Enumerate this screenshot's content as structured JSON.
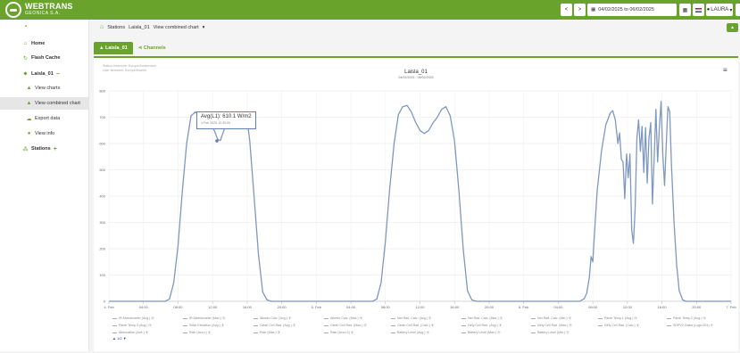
{
  "app": {
    "brand": "WEBTRANS",
    "brand_sub": "GEONICA S.A."
  },
  "topbar": {
    "prev": "<",
    "next": ">",
    "date_range": "04/02/2025 to 06/02/2025",
    "user": "LAURA"
  },
  "sidebar": {
    "items": [
      {
        "label": "Home",
        "icon": "home-icon"
      },
      {
        "label": "Flash Cache",
        "icon": "refresh-icon"
      },
      {
        "label": "Laisla_01",
        "icon": "map-marker-icon"
      },
      {
        "label": "View charts",
        "icon": "chart-icon"
      },
      {
        "label": "View combined chart",
        "icon": "chart-icon"
      },
      {
        "label": "Export data",
        "icon": "cloud-download-icon"
      },
      {
        "label": "View info",
        "icon": "info-icon"
      },
      {
        "label": "Stations",
        "icon": "sitemap-icon"
      }
    ],
    "collapse_sign": "−",
    "add_sign": "+"
  },
  "breadcrumb": {
    "items": [
      "Stations",
      "Laisla_01",
      "View combined chart"
    ]
  },
  "tabs": {
    "station": "Laisla_01",
    "channels": "Channels"
  },
  "chart": {
    "tz_station": "Station timezone: Europe/Amsterdam",
    "tz_user": "User timezone: Europe/Madrid",
    "menu_glyph": "≡",
    "tooltip_value": "Avg(L1): 610.1 W/m2",
    "tooltip_time": "4 Feb 2025 12:30:00",
    "legend_more": "▲ 1/2 ▼",
    "legend": [
      "IR Albedometer (Avg.) ⦿",
      "IR Albedometer (Max.) ⦿",
      "Albedo Calc. (Avg.) ⦿",
      "Albedo Calc. (Max.) ⦿",
      "Net Rad. Calc. (Avg.) ⦿",
      "Net Rad. Calc. (Max.) ⦿",
      "Net Rad. Calc. (Min.) ⦿",
      "Panel Temp.1 (Avg.) ⦿",
      "Panel Temp.2 (Avg.) ⦿",
      "Panel Temp.3 (Avg.) ⦿",
      "Solar Elevation (Avg.) ⦿",
      "Clean Cell Rad. (Avg.) ⦿",
      "Clean Cell Rad. (Max.) ⦿",
      "Clean Cell Rad. (Calc.) ⦿",
      "Dirty Cell Rad. (Avg.) ⦿",
      "Dirty Cell Rad. (Max.) ⦿",
      "Dirty Cell Rad. (Calc.) ⦿",
      "SDPV2 Gains (Logo.001) ⦿",
      "Attenuation (Ave.) ⦿",
      "Rain (Accu.) ⦿",
      "Rain (Max.) ⦿",
      "Rain (Accu.2) ⦿",
      "Battery Level (Avg.) ⦿",
      "Battery Level (Max.) ⦿",
      "Battery Level (Min.) ⦿"
    ]
  },
  "chart_data": {
    "type": "line",
    "title": "Laisla_01",
    "subtitle": "04/02/2025 - 06/02/2025",
    "x_tick_labels": [
      "4. Feb",
      "04:00",
      "08:00",
      "12:00",
      "16:00",
      "20:00",
      "5. Feb",
      "04:00",
      "08:00",
      "12:00",
      "16:00",
      "20:00",
      "6. Feb",
      "04:00",
      "08:00",
      "12:00",
      "16:00",
      "20:00",
      "7. Feb"
    ],
    "y_tick_labels": [
      "0",
      "100",
      "200",
      "300",
      "400",
      "500",
      "600",
      "700",
      "800"
    ],
    "ylim": [
      0,
      800
    ],
    "x_unit": "hours since 4. Feb 00:00",
    "xlim": [
      0,
      72
    ],
    "grid": true,
    "series": [
      {
        "name": "",
        "color": "#7f98bf",
        "points": [
          [
            0,
            0
          ],
          [
            6.5,
            0
          ],
          [
            7,
            8
          ],
          [
            7.5,
            70
          ],
          [
            8,
            210
          ],
          [
            8.5,
            420
          ],
          [
            9,
            600
          ],
          [
            9.5,
            705
          ],
          [
            10,
            720
          ],
          [
            10.5,
            705
          ],
          [
            11,
            700
          ],
          [
            11.5,
            690
          ],
          [
            12,
            665
          ],
          [
            12.3,
            640
          ],
          [
            12.6,
            615
          ],
          [
            12.9,
            612
          ],
          [
            13.3,
            650
          ],
          [
            13.7,
            690
          ],
          [
            14,
            700
          ],
          [
            14.5,
            695
          ],
          [
            15,
            680
          ],
          [
            15.5,
            710
          ],
          [
            15.9,
            720
          ],
          [
            16.3,
            610
          ],
          [
            16.8,
            400
          ],
          [
            17.3,
            180
          ],
          [
            17.8,
            35
          ],
          [
            18.3,
            5
          ],
          [
            18.8,
            0
          ],
          [
            30.5,
            0
          ],
          [
            31,
            8
          ],
          [
            31.5,
            70
          ],
          [
            32,
            230
          ],
          [
            32.5,
            430
          ],
          [
            33,
            600
          ],
          [
            33.5,
            710
          ],
          [
            34,
            740
          ],
          [
            34.5,
            745
          ],
          [
            35,
            720
          ],
          [
            35.5,
            680
          ],
          [
            36,
            650
          ],
          [
            36.5,
            638
          ],
          [
            37,
            650
          ],
          [
            37.5,
            678
          ],
          [
            38,
            700
          ],
          [
            38.5,
            730
          ],
          [
            39,
            740
          ],
          [
            39.5,
            705
          ],
          [
            40,
            610
          ],
          [
            40.5,
            420
          ],
          [
            41,
            200
          ],
          [
            41.5,
            40
          ],
          [
            42,
            5
          ],
          [
            42.5,
            0
          ],
          [
            54.5,
            0
          ],
          [
            55,
            10
          ],
          [
            55.3,
            30
          ],
          [
            55.6,
            90
          ],
          [
            55.8,
            170
          ],
          [
            56,
            150
          ],
          [
            56.2,
            260
          ],
          [
            56.5,
            420
          ],
          [
            57,
            570
          ],
          [
            57.5,
            670
          ],
          [
            58,
            715
          ],
          [
            58.3,
            725
          ],
          [
            58.6,
            690
          ],
          [
            58.9,
            600
          ],
          [
            59.1,
            640
          ],
          [
            59.3,
            540
          ],
          [
            59.5,
            530
          ],
          [
            59.7,
            390
          ],
          [
            59.9,
            560
          ],
          [
            60.1,
            470
          ],
          [
            60.3,
            560
          ],
          [
            60.5,
            270
          ],
          [
            60.7,
            220
          ],
          [
            60.9,
            350
          ],
          [
            61.1,
            620
          ],
          [
            61.3,
            690
          ],
          [
            61.5,
            570
          ],
          [
            61.7,
            665
          ],
          [
            61.9,
            490
          ],
          [
            62.1,
            660
          ],
          [
            62.3,
            450
          ],
          [
            62.5,
            620
          ],
          [
            62.7,
            680
          ],
          [
            62.9,
            370
          ],
          [
            63.1,
            540
          ],
          [
            63.3,
            730
          ],
          [
            63.5,
            530
          ],
          [
            63.7,
            660
          ],
          [
            63.9,
            760
          ],
          [
            64.1,
            560
          ],
          [
            64.3,
            440
          ],
          [
            64.5,
            600
          ],
          [
            64.7,
            740
          ],
          [
            64.9,
            720
          ],
          [
            65.1,
            520
          ],
          [
            65.4,
            300
          ],
          [
            65.7,
            140
          ],
          [
            66,
            40
          ],
          [
            66.4,
            5
          ],
          [
            66.8,
            0
          ],
          [
            72,
            0
          ]
        ]
      }
    ]
  }
}
